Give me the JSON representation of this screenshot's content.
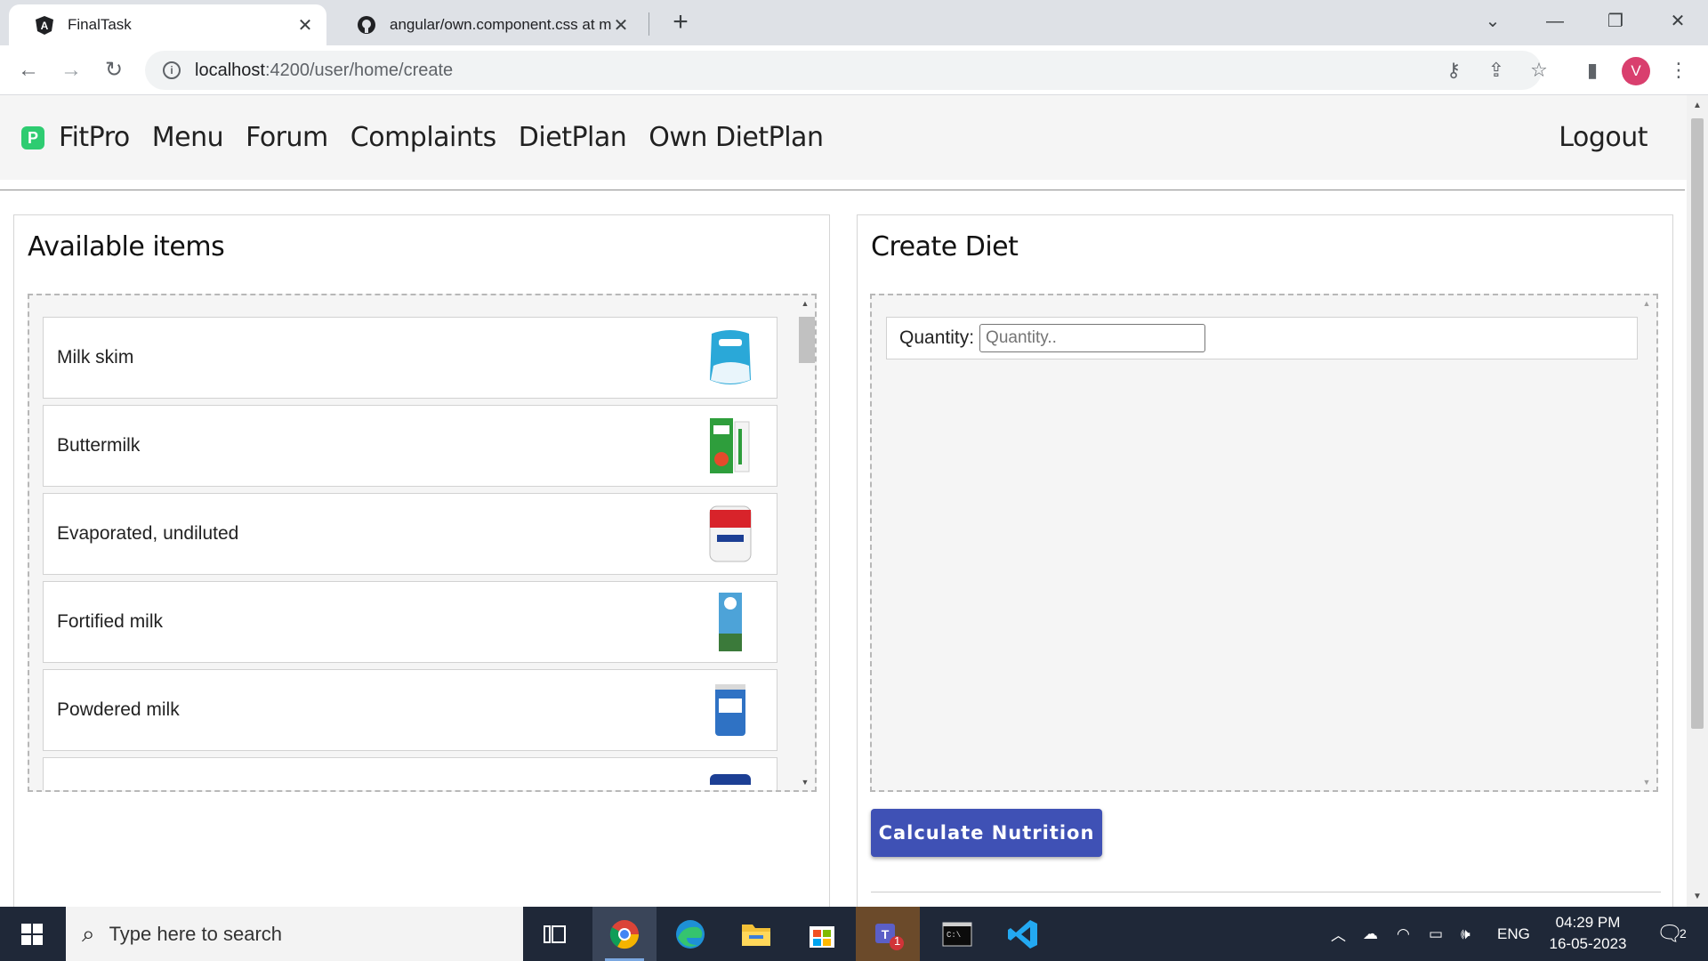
{
  "browser": {
    "tabs": [
      {
        "title": "FinalTask",
        "active": true,
        "icon": "angular-icon"
      },
      {
        "title": "angular/own.component.css at m",
        "active": false,
        "icon": "github-icon"
      }
    ],
    "url_host": "localhost",
    "url_path": ":4200/user/home/create",
    "profile_initial": "V"
  },
  "nav": {
    "brand": "FitPro",
    "links": [
      "Menu",
      "Forum",
      "Complaints",
      "DietPlan",
      "Own DietPlan"
    ],
    "logout": "Logout"
  },
  "available": {
    "title": "Available items",
    "items": [
      {
        "name": "Milk skim",
        "image": "milk-skim-pack"
      },
      {
        "name": "Buttermilk",
        "image": "buttermilk-carton"
      },
      {
        "name": "Evaporated, undiluted",
        "image": "evaporated-milk-can"
      },
      {
        "name": "Fortified milk",
        "image": "fortified-milk-carton"
      },
      {
        "name": "Powdered milk",
        "image": "powdered-milk-tin"
      },
      {
        "name": "",
        "image": "mix-n-drink-pack"
      }
    ]
  },
  "create": {
    "title": "Create Diet",
    "quantity_label": "Quantity:",
    "quantity_placeholder": "Quantity..",
    "calc_button": "Calculate Nutrition"
  },
  "taskbar": {
    "search_placeholder": "Type here to search",
    "language": "ENG",
    "time": "04:29 PM",
    "date": "16-05-2023",
    "notifications": "2",
    "teams_badge": "1"
  },
  "colors": {
    "accent": "#3f51b5",
    "brand_icon": "#2ecc71",
    "appbar_bg": "#f5f5f5",
    "taskbar_bg": "#1f2838"
  }
}
